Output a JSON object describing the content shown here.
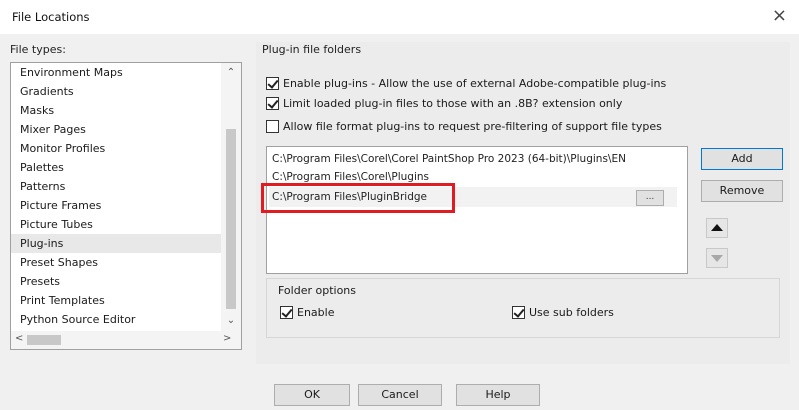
{
  "window": {
    "title": "File Locations",
    "close_glyph": "×"
  },
  "file_types": {
    "label": "File types:",
    "items": [
      "Environment Maps",
      "Gradients",
      "Masks",
      "Mixer Pages",
      "Monitor Profiles",
      "Palettes",
      "Patterns",
      "Picture Frames",
      "Picture Tubes",
      "Plug-ins",
      "Preset Shapes",
      "Presets",
      "Print Templates",
      "Python Source Editor"
    ],
    "selected": "Plug-ins"
  },
  "plugins": {
    "label": "Plug-in file folders",
    "checkboxes": [
      {
        "label": "Enable plug-ins - Allow the use of external Adobe-compatible plug-ins",
        "checked": true
      },
      {
        "label": "Limit loaded plug-in files to those with an .8B? extension only",
        "checked": true
      },
      {
        "label": "Allow file format plug-ins to request pre-filtering of support file types",
        "checked": false
      }
    ],
    "folders": [
      "C:\\Program Files\\Corel\\Corel PaintShop Pro 2023 (64-bit)\\Plugins\\EN",
      "C:\\Program Files\\Corel\\Plugins",
      "C:\\Program Files\\PluginBridge"
    ],
    "browse_label": "...",
    "add_label": "Add",
    "remove_label": "Remove"
  },
  "folder_options": {
    "label": "Folder options",
    "enable_label": "Enable",
    "enable_checked": true,
    "subfolders_label": "Use sub folders",
    "subfolders_checked": true
  },
  "footer": {
    "ok_label": "OK",
    "cancel_label": "Cancel",
    "help_label": "Help"
  },
  "colors": {
    "highlight": "#e01b22",
    "default_button_border": "#0078d7"
  }
}
